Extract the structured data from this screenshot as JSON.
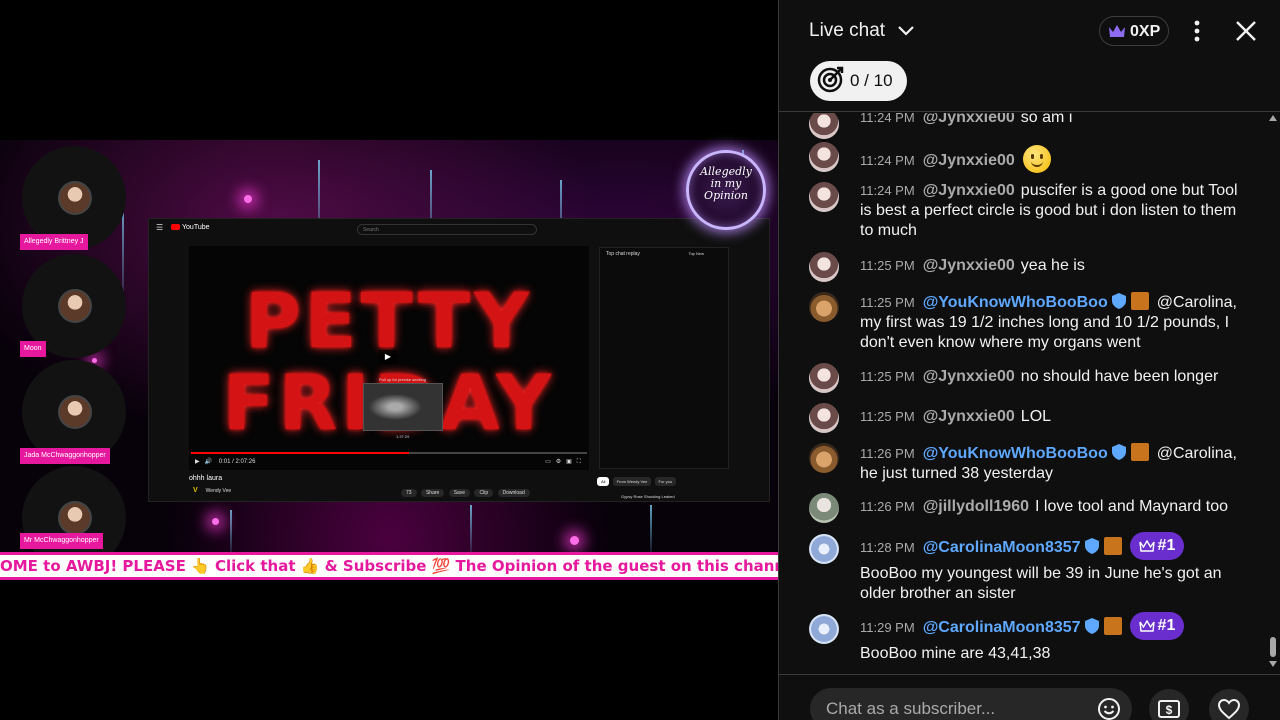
{
  "stream": {
    "guests": [
      {
        "name": "Allegedly Brittney J"
      },
      {
        "name": "Moon"
      },
      {
        "name": "Jada McChwaggonhopper"
      },
      {
        "name": "Mr McChwaggonhopper"
      }
    ],
    "embedded_video": {
      "site_name": "YouTube",
      "search_placeholder": "Search",
      "title_line1": "PETTY",
      "title_line2": "FRIDAY",
      "pull_up_text": "Pull up for precise seeking",
      "preview_time": "1:37:29",
      "time_display": "0:01 / 2:07:26",
      "video_title": "ohhh laura",
      "channel_name": "Wendy Vee",
      "subscribers": "1.63k subscribers",
      "likes": "73",
      "share": "Share",
      "save": "Save",
      "clip": "Clip",
      "download": "Download",
      "chat_header": "Top chat replay",
      "chat_mode": "Top New",
      "tab_all": "All",
      "tab_from": "From Wendy Vee",
      "tab_foryou": "For you",
      "related_title": "Gypsy Rose Shocking Leaked"
    },
    "channel_badge": {
      "line1": "Allegedly",
      "line2": "in my",
      "line3": "Opinion"
    },
    "ticker_text": "OME to AWBJ! PLEASE 👆 Click that 👍 & Subscribe 💯 The Opinion of the guest on this channel ar"
  },
  "chat": {
    "title": "Live chat",
    "xp": "0XP",
    "goal": "0 / 10",
    "input_placeholder": "Chat as a subscriber...",
    "messages": [
      {
        "time": "11:24 PM",
        "author": "@Jynxxie00",
        "text": "so am i"
      },
      {
        "time": "11:24 PM",
        "author": "@Jynxxie00",
        "text": ""
      },
      {
        "time": "11:24 PM",
        "author": "@Jynxxie00",
        "text": "puscifer is a good one but Tool is best a perfect circle is good but i don listen to them to much"
      },
      {
        "time": "11:25 PM",
        "author": "@Jynxxie00",
        "text": "yea he is"
      },
      {
        "time": "11:25 PM",
        "author": "@YouKnowWhoBooBoo",
        "text": "@Carolina, my first was 19 1/2 inches long and 10 1/2 pounds, I don't even know where my organs went"
      },
      {
        "time": "11:25 PM",
        "author": "@Jynxxie00",
        "text": "no should have been longer"
      },
      {
        "time": "11:25 PM",
        "author": "@Jynxxie00",
        "text": "LOL"
      },
      {
        "time": "11:26 PM",
        "author": "@YouKnowWhoBooBoo",
        "text": "@Carolina, he just turned 38 yesterday"
      },
      {
        "time": "11:26 PM",
        "author": "@jillydoll1960",
        "text": "I love tool and Maynard too"
      },
      {
        "time": "11:28 PM",
        "author": "@CarolinaMoon8357",
        "rank": "#1",
        "text": "BooBoo my youngest will be 39 in June he's got an older brother an sister"
      },
      {
        "time": "11:29 PM",
        "author": "@CarolinaMoon8357",
        "rank": "#1",
        "text": "BooBoo mine are 43,41,38"
      }
    ]
  },
  "colors": {
    "chat_bg": "#0f0f0f",
    "moderator_blue": "#5ea8ff",
    "rank_purple": "#6a2ecf",
    "stream_pink": "#e6189e",
    "petty_red": "#d41414"
  }
}
